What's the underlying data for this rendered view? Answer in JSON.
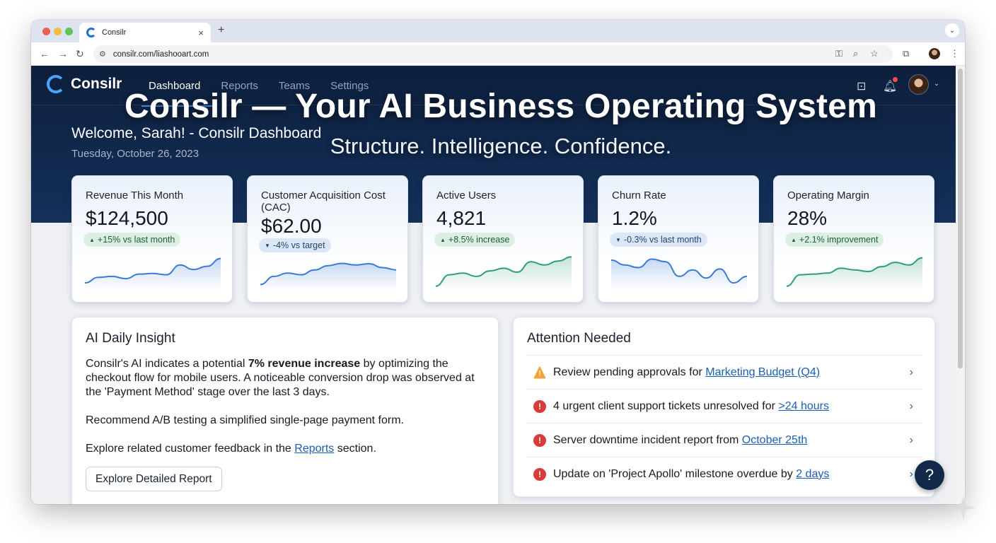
{
  "browser": {
    "tab_title": "Consilr",
    "tab_close": "×",
    "new_tab": "+",
    "tab_menu": "⌄",
    "url": "consilr.com/liashooart.com",
    "icons": [
      "back-icon",
      "forward-icon",
      "reload-icon",
      "site-settings-icon",
      "password-key-icon",
      "zoom-icon",
      "bookmark-star-icon",
      "extensions-icon",
      "profile-avatar",
      "menu-icon"
    ]
  },
  "app": {
    "logo_text": "Consilr",
    "nav": [
      "Dashboard",
      "Reports",
      "Teams",
      "Settings"
    ],
    "active_nav": "Dashboard",
    "overlay_title": "Consilr — Your AI Business Operating System",
    "overlay_subtitle": "Structure. Intelligence. Confidence.",
    "welcome": "Welcome, Sarah! - Consilr Dashboard",
    "date": "Tuesday, October 26, 2023",
    "colors": {
      "hero": "#0d1f3c",
      "accent": "#3f8ef0",
      "positive": "#1f5d3a",
      "alert": "#d93b3b",
      "warning": "#f2a43a"
    }
  },
  "kpis": [
    {
      "label": "Revenue This Month",
      "value": "$124,500",
      "delta": "+15% vs last month",
      "trend": "up",
      "color": "#3a7bd5",
      "spark": [
        0.15,
        0.32,
        0.35,
        0.28,
        0.42,
        0.44,
        0.4,
        0.7,
        0.56,
        0.66,
        0.9
      ]
    },
    {
      "label": "Customer Acquisition Cost (CAC)",
      "value": "$62.00",
      "delta": "-4% vs target",
      "trend": "down",
      "color": "#3a7bd5",
      "spark": [
        0.1,
        0.35,
        0.45,
        0.4,
        0.55,
        0.68,
        0.75,
        0.7,
        0.74,
        0.62,
        0.55
      ]
    },
    {
      "label": "Active Users",
      "value": "4,821",
      "delta": "+8.5% increase",
      "trend": "up",
      "color": "#2f9c7a",
      "spark": [
        0.05,
        0.4,
        0.45,
        0.35,
        0.52,
        0.6,
        0.48,
        0.8,
        0.7,
        0.82,
        0.95
      ]
    },
    {
      "label": "Churn Rate",
      "value": "1.2%",
      "delta": "-0.3% vs last month",
      "trend": "down",
      "color": "#3a7bd5",
      "spark": [
        0.85,
        0.7,
        0.62,
        0.88,
        0.8,
        0.35,
        0.55,
        0.3,
        0.58,
        0.15,
        0.35
      ]
    },
    {
      "label": "Operating Margin",
      "value": "28%",
      "delta": "+2.1% improvement",
      "trend": "up",
      "color": "#2f9c7a",
      "spark": [
        0.05,
        0.4,
        0.42,
        0.45,
        0.6,
        0.55,
        0.5,
        0.65,
        0.78,
        0.7,
        0.92
      ]
    }
  ],
  "insight": {
    "title": "AI Daily Insight",
    "p1_a": "Consilr's AI indicates a potential ",
    "p1_bold": "7% revenue increase",
    "p1_b": " by optimizing the checkout flow for mobile users. A noticeable conversion drop was observed at the 'Payment Method' stage over the last 3 days.",
    "p2": "Recommend A/B testing a simplified single-page payment form.",
    "p3_a": "Explore related customer feedback in the ",
    "p3_link": "Reports",
    "p3_b": " section.",
    "button": "Explore Detailed Report"
  },
  "attention": {
    "title": "Attention Needed",
    "items": [
      {
        "icon": "warning-icon",
        "type": "warn",
        "symbol": "!",
        "text": "Review pending approvals for ",
        "link": "Marketing Budget (Q4)"
      },
      {
        "icon": "error-icon",
        "type": "err",
        "symbol": "!",
        "text": "4 urgent client support tickets unresolved for ",
        "link": ">24 hours"
      },
      {
        "icon": "error-icon",
        "type": "err",
        "symbol": "!",
        "text": "Server downtime incident report from ",
        "link": "October 25th"
      },
      {
        "icon": "error-icon",
        "type": "err",
        "symbol": "!",
        "text": "Update on 'Project Apollo' milestone overdue by ",
        "link": "2 days"
      }
    ]
  },
  "help_label": "?"
}
